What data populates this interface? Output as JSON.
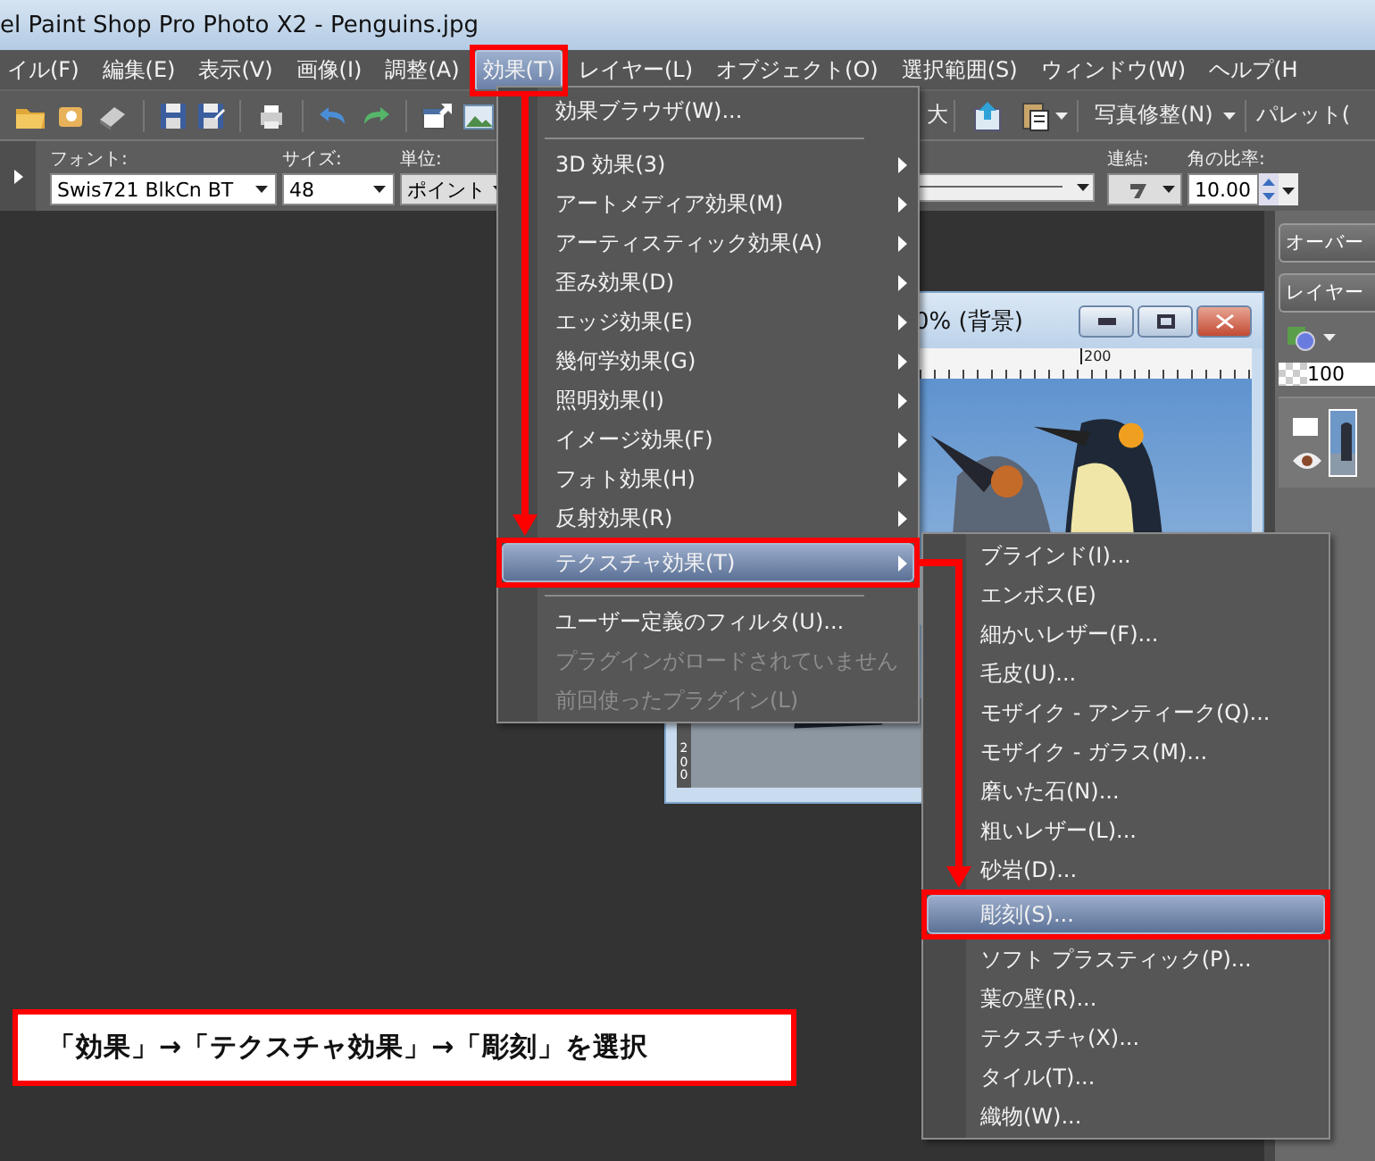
{
  "window": {
    "title": "el Paint Shop Pro Photo X2 - Penguins.jpg"
  },
  "menu_bar": [
    {
      "label": "イル(F)",
      "selected": false
    },
    {
      "label": "編集(E)",
      "selected": false
    },
    {
      "label": "表示(V)",
      "selected": false
    },
    {
      "label": "画像(I)",
      "selected": false
    },
    {
      "label": "調整(A)",
      "selected": false
    },
    {
      "label": "効果(T)",
      "selected": true
    },
    {
      "label": "レイヤー(L)",
      "selected": false
    },
    {
      "label": "オブジェクト(O)",
      "selected": false
    },
    {
      "label": "選択範囲(S)",
      "selected": false
    },
    {
      "label": "ウィンドウ(W)",
      "selected": false
    },
    {
      "label": "ヘルプ(H",
      "selected": false
    }
  ],
  "toolbar": {
    "zoom_label": "大",
    "photo_fix": "写真修整(N)",
    "palettes": "パレット("
  },
  "text_options": {
    "font_label": "フォント:",
    "font": "Swis721 BlkCn BT",
    "size_label": "サイズ:",
    "size": "48",
    "unit_label": "単位:",
    "unit": "ポイント",
    "link_label": "連結:",
    "aspect_label": "角の比率:",
    "aspect": "10.00"
  },
  "palette": {
    "tabs": [
      "オーバー",
      "レイヤー"
    ],
    "opacity": "100"
  },
  "image_window": {
    "title": "0% (背景)",
    "ruler_label": "200",
    "vertical_ruler_label": "200"
  },
  "effects_menu": [
    {
      "kind": "item",
      "label": "効果ブラウザ(W)...",
      "submenu": false,
      "selected": false,
      "disabled": false
    },
    {
      "kind": "separator"
    },
    {
      "kind": "item",
      "label": "3D 効果(3)",
      "submenu": true,
      "selected": false,
      "disabled": false
    },
    {
      "kind": "item",
      "label": "アートメディア効果(M)",
      "submenu": true,
      "selected": false,
      "disabled": false
    },
    {
      "kind": "item",
      "label": "アーティスティック効果(A)",
      "submenu": true,
      "selected": false,
      "disabled": false
    },
    {
      "kind": "item",
      "label": "歪み効果(D)",
      "submenu": true,
      "selected": false,
      "disabled": false
    },
    {
      "kind": "item",
      "label": "エッジ効果(E)",
      "submenu": true,
      "selected": false,
      "disabled": false
    },
    {
      "kind": "item",
      "label": "幾何学効果(G)",
      "submenu": true,
      "selected": false,
      "disabled": false
    },
    {
      "kind": "item",
      "label": "照明効果(I)",
      "submenu": true,
      "selected": false,
      "disabled": false
    },
    {
      "kind": "item",
      "label": "イメージ効果(F)",
      "submenu": true,
      "selected": false,
      "disabled": false
    },
    {
      "kind": "item",
      "label": "フォト効果(H)",
      "submenu": true,
      "selected": false,
      "disabled": false
    },
    {
      "kind": "item",
      "label": "反射効果(R)",
      "submenu": true,
      "selected": false,
      "disabled": false
    },
    {
      "kind": "item",
      "label": "テクスチャ効果(T)",
      "submenu": true,
      "selected": true,
      "disabled": false
    },
    {
      "kind": "separator"
    },
    {
      "kind": "item",
      "label": "ユーザー定義のフィルタ(U)...",
      "submenu": false,
      "selected": false,
      "disabled": false
    },
    {
      "kind": "item",
      "label": "プラグインがロードされていません",
      "submenu": false,
      "selected": false,
      "disabled": true
    },
    {
      "kind": "item",
      "label": "前回使ったプラグイン(L)",
      "submenu": false,
      "selected": false,
      "disabled": true
    }
  ],
  "texture_submenu": [
    {
      "label": "ブラインド(I)...",
      "selected": false
    },
    {
      "label": "エンボス(E)",
      "selected": false
    },
    {
      "label": "細かいレザー(F)...",
      "selected": false
    },
    {
      "label": "毛皮(U)...",
      "selected": false
    },
    {
      "label": "モザイク - アンティーク(Q)...",
      "selected": false
    },
    {
      "label": "モザイク - ガラス(M)...",
      "selected": false
    },
    {
      "label": "磨いた石(N)...",
      "selected": false
    },
    {
      "label": "粗いレザー(L)...",
      "selected": false
    },
    {
      "label": "砂岩(D)...",
      "selected": false
    },
    {
      "label": "彫刻(S)...",
      "selected": true
    },
    {
      "label": "ソフト プラスティック(P)...",
      "selected": false
    },
    {
      "label": "葉の壁(R)...",
      "selected": false
    },
    {
      "label": "テクスチャ(X)...",
      "selected": false
    },
    {
      "label": "タイル(T)...",
      "selected": false
    },
    {
      "label": "織物(W)...",
      "selected": false
    }
  ],
  "callout": {
    "text": "「効果」→「テクスチャ効果」→「彫刻」を選択"
  }
}
